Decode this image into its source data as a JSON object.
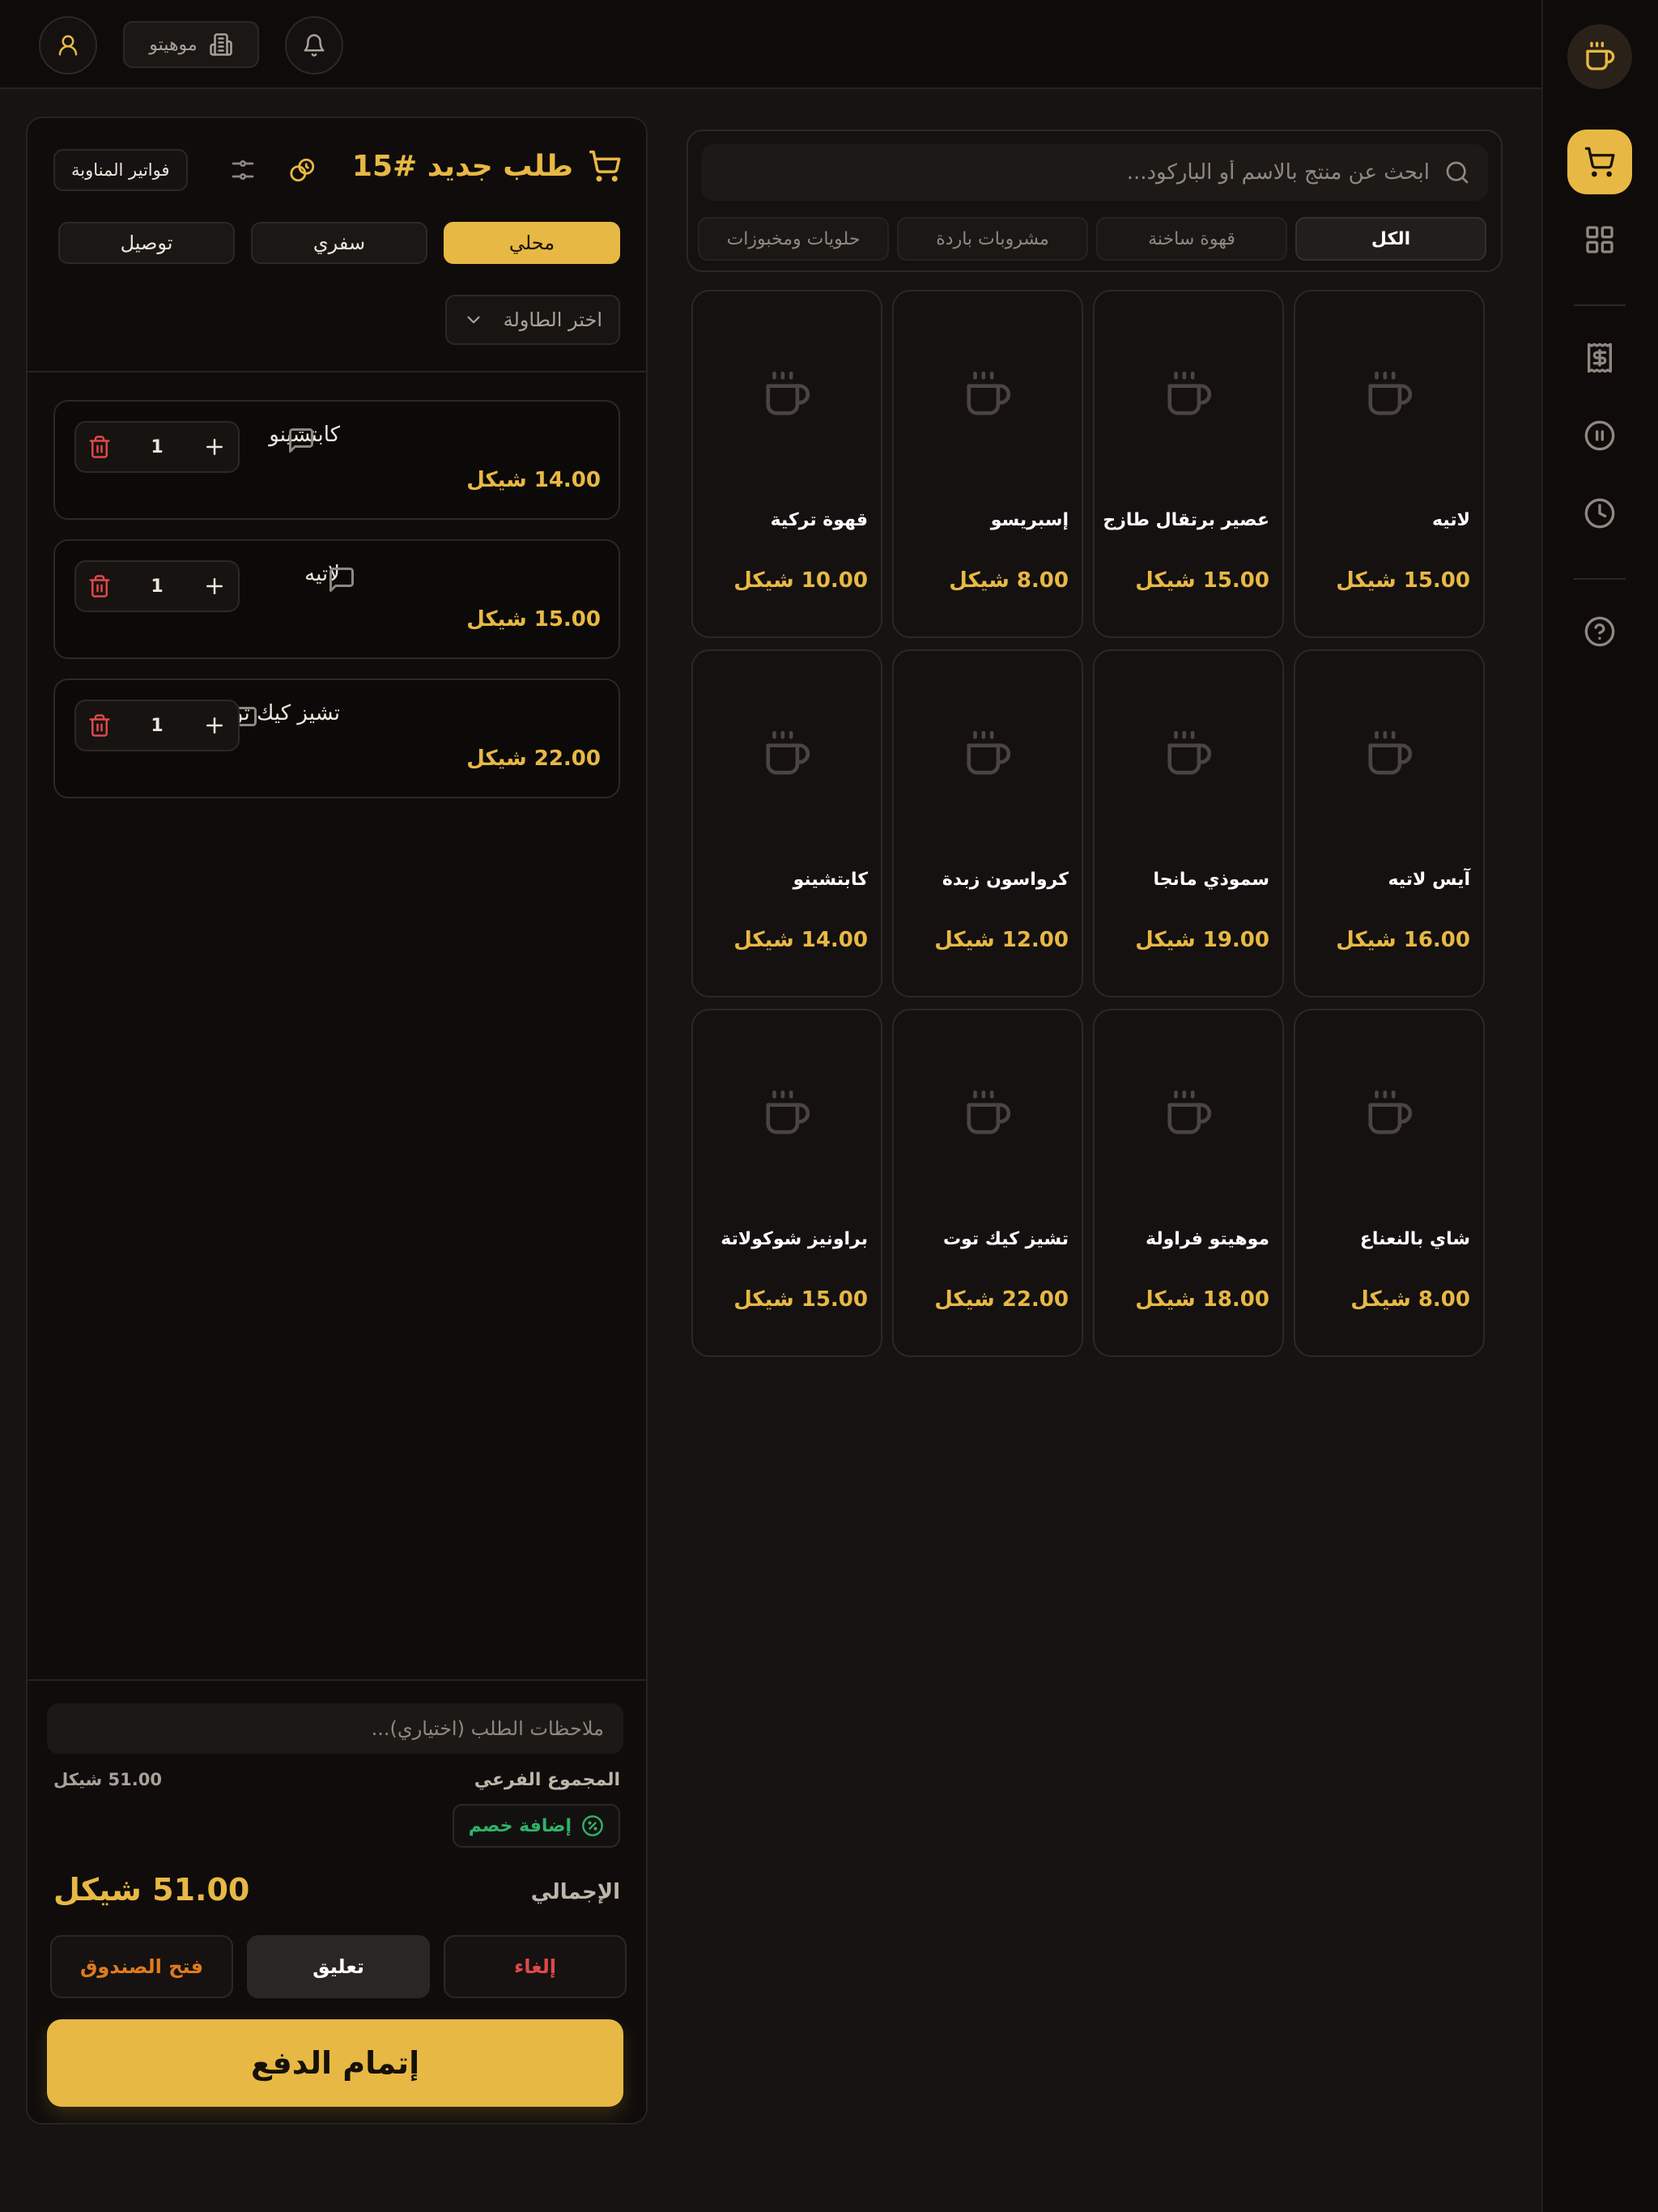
{
  "colors": {
    "accent": "#e8b844",
    "danger": "#e04848",
    "success": "#2fb36b",
    "warning": "#e07a1f",
    "background": "#161311"
  },
  "topbar": {
    "branch_name": "موهيتو"
  },
  "search": {
    "placeholder": "ابحث عن منتج بالاسم أو الباركود..."
  },
  "categories": [
    "الكل",
    "قهوة ساخنة",
    "مشروبات باردة",
    "حلويات ومخبوزات"
  ],
  "products": [
    {
      "name": "لاتيه",
      "price": "15.00 شيكل"
    },
    {
      "name": "عصير برتقال طازج",
      "price": "15.00 شيكل"
    },
    {
      "name": "إسبريسو",
      "price": "8.00 شيكل"
    },
    {
      "name": "قهوة تركية",
      "price": "10.00 شيكل"
    },
    {
      "name": "آيس لاتيه",
      "price": "16.00 شيكل"
    },
    {
      "name": "سموذي مانجا",
      "price": "19.00 شيكل"
    },
    {
      "name": "كرواسون زبدة",
      "price": "12.00 شيكل"
    },
    {
      "name": "كابتشينو",
      "price": "14.00 شيكل"
    },
    {
      "name": "شاي بالنعناع",
      "price": "8.00 شيكل"
    },
    {
      "name": "موهيتو فراولة",
      "price": "18.00 شيكل"
    },
    {
      "name": "تشيز كيك توت",
      "price": "22.00 شيكل"
    },
    {
      "name": "براونيز شوكولاتة",
      "price": "15.00 شيكل"
    }
  ],
  "order": {
    "title": "طلب جديد #15",
    "shift_invoices_label": "فواتير المناوبة",
    "types": [
      "محلي",
      "سفري",
      "توصيل"
    ],
    "active_type": "محلي",
    "table_select": "اختر الطاولة",
    "items": [
      {
        "name": "كابتشينو",
        "qty": "1",
        "price": "14.00 شيكل"
      },
      {
        "name": "لاتيه",
        "qty": "1",
        "price": "15.00 شيكل"
      },
      {
        "name": "تشيز كيك توت",
        "qty": "1",
        "price": "22.00 شيكل"
      }
    ],
    "notes_placeholder": "ملاحظات الطلب (اختياري)...",
    "subtotal_label": "المجموع الفرعي",
    "subtotal_value": "51.00 شيكل",
    "discount_label": "إضافة خصم",
    "total_label": "الإجمالي",
    "total_value": "51.00 شيكل",
    "cancel_label": "إلغاء",
    "hold_label": "تعليق",
    "open_drawer_label": "فتح الصندوق",
    "pay_label": "إتمام الدفع"
  },
  "icons": {
    "sidebar": [
      "coffee-logo-icon",
      "cart-icon",
      "grid-icon",
      "receipt-icon",
      "pause-icon",
      "clock-icon",
      "help-icon"
    ],
    "topbar": [
      "bell-icon",
      "building-icon",
      "user-icon"
    ]
  }
}
